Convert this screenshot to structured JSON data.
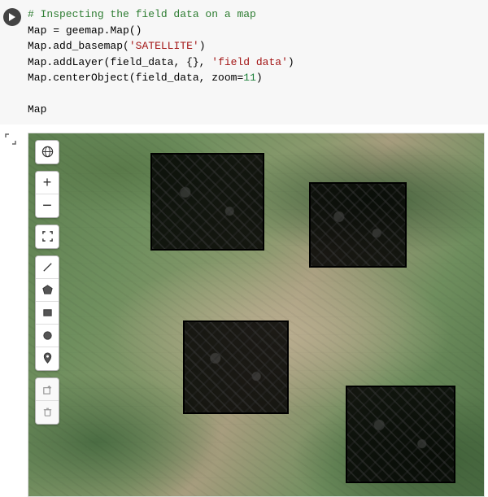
{
  "code": {
    "comment": "# Inspecting the field data on a map",
    "l1a": "Map ",
    "l1b": "=",
    "l1c": " geemap",
    "l1d": ".",
    "l1e": "Map",
    "l1f": "()",
    "l2a": "Map",
    "l2b": ".",
    "l2c": "add_basemap",
    "l2d": "(",
    "l2e": "'SATELLITE'",
    "l2f": ")",
    "l3a": "Map",
    "l3b": ".",
    "l3c": "addLayer",
    "l3d": "(field_data, {}, ",
    "l3e": "'field data'",
    "l3f": ")",
    "l4a": "Map",
    "l4b": ".",
    "l4c": "centerObject",
    "l4d": "(field_data, zoom",
    "l4e": "=",
    "l4f": "11",
    "l4g": ")",
    "l5": "Map"
  },
  "controls": {
    "globe": "globe",
    "zoom_in": "+",
    "zoom_out": "−",
    "fullscreen": "fullscreen",
    "draw_line": "line",
    "draw_polygon": "polygon",
    "draw_rect": "rectangle",
    "draw_circle": "circle",
    "draw_marker": "marker",
    "edit": "edit",
    "trash": "delete"
  }
}
